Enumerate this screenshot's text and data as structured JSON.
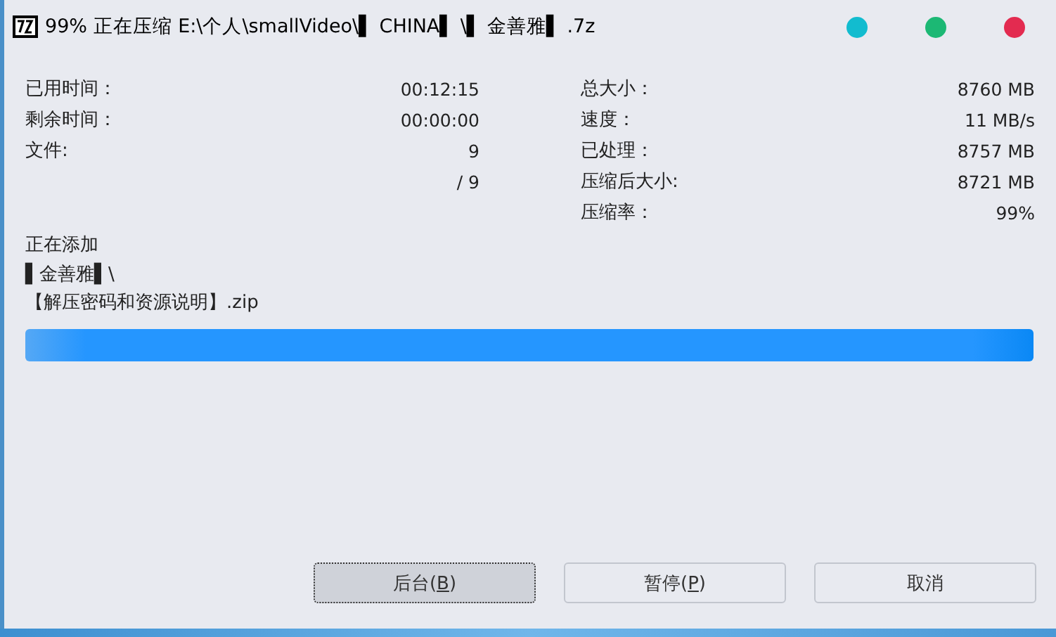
{
  "window": {
    "title": "99% 正在压缩 E:\\个人\\smallVideo\\▌ CHINA▌ \\▌ 金善雅▌ .7z",
    "controls": [
      {
        "color": "#12bccf"
      },
      {
        "color": "#1cb874"
      },
      {
        "color": "#e32b50"
      }
    ]
  },
  "stats_left": [
    {
      "label": "已用时间：",
      "value": "00:12:15"
    },
    {
      "label": "剩余时间：",
      "value": "00:00:00"
    },
    {
      "label": "文件:",
      "value": "9"
    },
    {
      "value": "/ 9"
    }
  ],
  "stats_right": [
    {
      "label": "总大小：",
      "value": "8760 MB"
    },
    {
      "label": "速度：",
      "value": "11 MB/s"
    },
    {
      "label": "已处理：",
      "value": "8757 MB"
    },
    {
      "label": "压缩后大小:",
      "value": "8721 MB"
    },
    {
      "label": "压缩率：",
      "value": "99%"
    }
  ],
  "current": {
    "heading": "正在添加",
    "lines": [
      "▌金善雅▌\\",
      "【解压密码和资源说明】.zip"
    ]
  },
  "progress": {
    "level": 1.0
  },
  "buttons": [
    {
      "before": "后台(",
      "mnemonic": "B",
      "after": ")",
      "focused": true
    },
    {
      "before": "暂停(",
      "mnemonic": "P",
      "after": ")",
      "focused": false
    },
    {
      "before": "取消",
      "focused": false
    }
  ]
}
